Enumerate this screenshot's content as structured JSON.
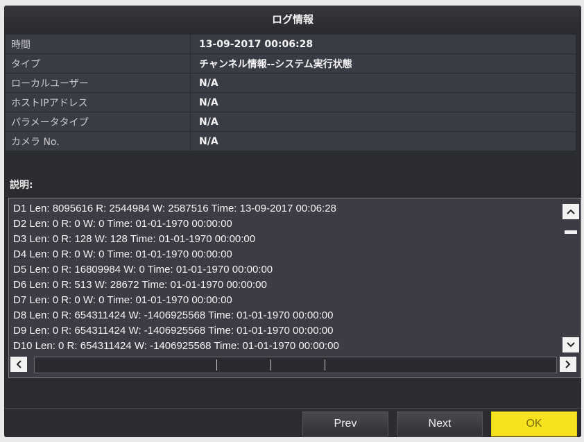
{
  "dialog": {
    "title": "ログ情報"
  },
  "info_rows": [
    {
      "label": "時間",
      "value": "13-09-2017 00:06:28"
    },
    {
      "label": "タイプ",
      "value": "チャンネル情報--システム実行状態"
    },
    {
      "label": "ローカルユーザー",
      "value": "N/A"
    },
    {
      "label": "ホストIPアドレス",
      "value": "N/A"
    },
    {
      "label": "パラメータタイプ",
      "value": "N/A"
    },
    {
      "label": "カメラ No.",
      "value": "N/A"
    }
  ],
  "description": {
    "label": "説明:",
    "lines": [
      "D1 Len: 8095616 R: 2544984 W: 2587516 Time: 13-09-2017 00:06:28",
      "D2 Len: 0 R: 0 W: 0 Time: 01-01-1970 00:00:00",
      "D3 Len: 0 R: 128 W: 128 Time: 01-01-1970 00:00:00",
      "D4 Len: 0 R: 0 W: 0 Time: 01-01-1970 00:00:00",
      "D5 Len: 0 R: 16809984 W: 0 Time: 01-01-1970 00:00:00",
      "D6 Len: 0 R: 513 W: 28672 Time: 01-01-1970 00:00:00",
      "D7 Len: 0 R: 0 W: 0 Time: 01-01-1970 00:00:00",
      "D8 Len: 0 R: 654311424 W: -1406925568 Time: 01-01-1970 00:00:00",
      "D9 Len: 0 R: 654311424 W: -1406925568 Time: 01-01-1970 00:00:00",
      "D10 Len: 0 R: 654311424 W: -1406925568 Time: 01-01-1970 00:00:00"
    ]
  },
  "icons": {
    "up": "^",
    "down": "v",
    "left": "<",
    "right": ">"
  },
  "buttons": {
    "prev": "Prev",
    "next": "Next",
    "ok": "OK"
  }
}
